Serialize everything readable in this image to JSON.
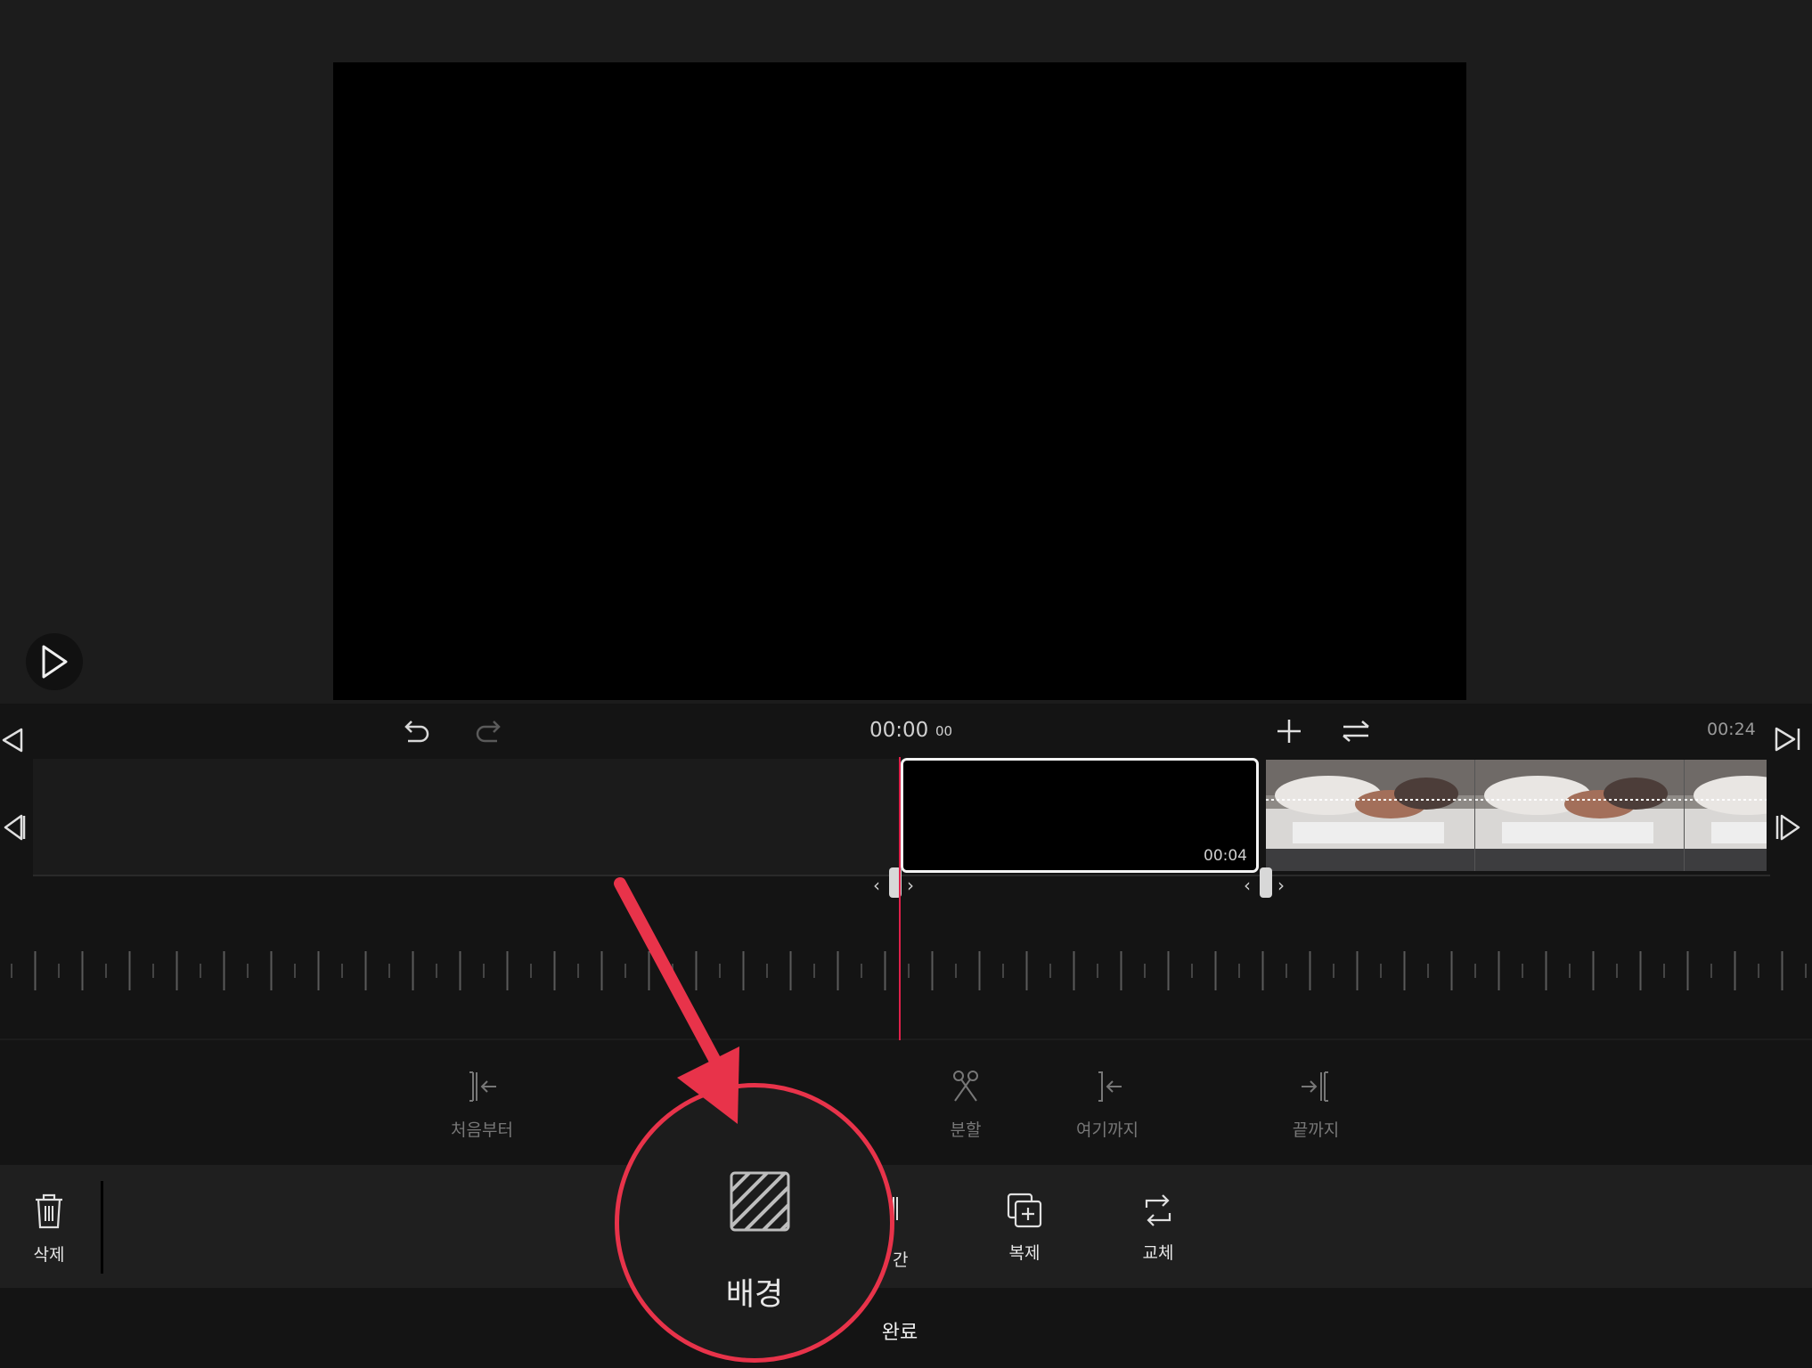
{
  "transport": {
    "current_time": "00:00",
    "current_frames": "00",
    "total_time": "00:24"
  },
  "timeline": {
    "selected_clip_duration": "00:04"
  },
  "trim_tools": [
    {
      "label": "처음부터",
      "icon": "trim-from-start-icon"
    },
    {
      "label": "",
      "icon": "trim-partial-icon"
    },
    {
      "label": "분할",
      "icon": "scissors-icon"
    },
    {
      "label": "여기까지",
      "icon": "trim-to-here-icon"
    },
    {
      "label": "끝까지",
      "icon": "trim-to-end-icon"
    }
  ],
  "edit_tools": {
    "delete": "삭제",
    "background": "배경",
    "partial": "간",
    "duplicate": "복제",
    "replace": "교체"
  },
  "done_label": "완료",
  "colors": {
    "playhead": "#e0204a",
    "annotation": "#e8334a"
  }
}
